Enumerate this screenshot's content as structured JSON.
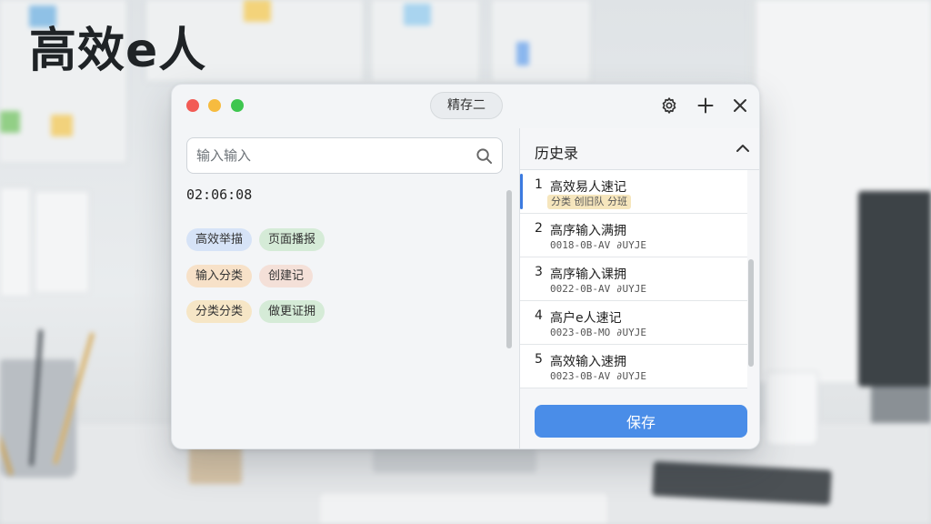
{
  "headline": "高效e人",
  "window": {
    "title": "精存二"
  },
  "icons": {
    "settings": "gear-icon",
    "add": "plus-icon",
    "close": "close-icon",
    "search": "search-icon",
    "collapse": "chevron-up-icon"
  },
  "search": {
    "placeholder": "输入输入"
  },
  "timer": "02:06:08",
  "tags": [
    {
      "label": "高效举描",
      "color": "#d6e3f7"
    },
    {
      "label": "页面播报",
      "color": "#d5ebd7"
    },
    {
      "label": "输入分类",
      "color": "#f7e1c8"
    },
    {
      "label": "创建记",
      "color": "#f4e0d8"
    },
    {
      "label": "分类分类",
      "color": "#f6e6c6"
    },
    {
      "label": "做更证拥",
      "color": "#d5ebd7"
    }
  ],
  "history": {
    "title": "历史录",
    "items": [
      {
        "num": "1",
        "name": "高效易人速记",
        "sub": "分类 创旧队 分班",
        "active": true
      },
      {
        "num": "2",
        "name": "高序输入满拥",
        "sub": "0018-0B-AV ∂UYJE"
      },
      {
        "num": "3",
        "name": "高序输入课拥",
        "sub": "0022-0B-AV ∂UYJE"
      },
      {
        "num": "4",
        "name": "高户e人速记",
        "sub": "0023-0B-MO ∂UYJE"
      },
      {
        "num": "5",
        "name": "高效输入速拥",
        "sub": "0023-0B-AV ∂UYJE"
      }
    ]
  },
  "save_label": "保存",
  "accent_color": "#4a8de8"
}
